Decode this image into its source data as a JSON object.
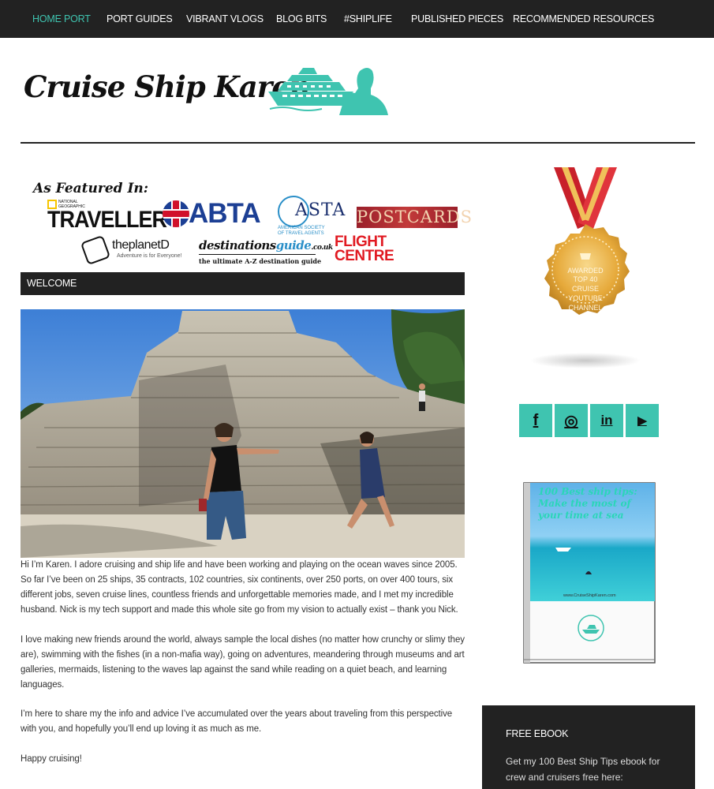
{
  "nav": {
    "items": [
      {
        "label": "HOME PORT",
        "active": true
      },
      {
        "label": "PORT GUIDES"
      },
      {
        "label": "VIBRANT VLOGS"
      },
      {
        "label": "BLOG BITS"
      },
      {
        "label": "#SHIPLIFE"
      },
      {
        "label": "PUBLISHED PIECES"
      },
      {
        "label": "RECOMMENDED RESOURCES"
      }
    ]
  },
  "header": {
    "logo_text": "Cruise Ship Karen"
  },
  "featured": {
    "title": "As Featured In:",
    "natgeo": "NATIONAL\nGEOGRAPHIC",
    "traveller": "TRAVELLER",
    "abta": "ABTA",
    "asta": "ASTA",
    "asta_sub": "AMERICAN SOCIETY\nOF TRAVEL AGENTS",
    "postcards": "POSTCARDS",
    "planetd": "theplanetD",
    "planetd_sub": "Adventure is for Everyone!",
    "destguide_a": "destinations",
    "destguide_b": "guide",
    "destguide_c": ".co.uk",
    "destguide_sub": "the ultimate A-Z destination guide",
    "flight": "FLIGHT\nCENTRE"
  },
  "welcome": {
    "title": "WELCOME",
    "paragraphs": [
      "Hi I’m Karen. I adore cruising and ship life and have been working and playing on the ocean waves since 2005. So far I’ve been on 25 ships, 35 contracts, 102 countries, six continents, over 250 ports, on over 400 tours, six different jobs, seven cruise lines, countless friends and unforgettable memories made, and I met my incredible husband. Nick is my tech support and made this whole site go from my vision to actually exist – thank you Nick.",
      "I love making new friends around the world, always sample the local dishes (no matter how crunchy or slimy they are), swimming with the fishes (in a non-mafia way), going on adventures, meandering through museums and art galleries, mermaids, listening to the waves lap against the sand while reading on a quiet beach, and learning languages.",
      "I’m here to share my the info and advice I’ve accumulated over the years about traveling from this perspective with you, and hopefully you’ll end up loving it as much as me.",
      "Happy cruising!"
    ]
  },
  "sidebar": {
    "badge_lines": [
      "AWARDED",
      "TOP 40",
      "CRUISE",
      "YOUTUBE",
      "CHANNEL"
    ],
    "social": [
      {
        "name": "facebook",
        "glyph": "f"
      },
      {
        "name": "instagram",
        "glyph": "◎"
      },
      {
        "name": "linkedin",
        "glyph": "in"
      },
      {
        "name": "youtube",
        "glyph": "▶"
      }
    ],
    "ebook_cover_title": "100 Best ship tips: Make the most of your time at sea",
    "ebook_url": "www.CruiseShipKaren.com",
    "free_title": "FREE EBOOK",
    "free_text": "Get my 100 Best Ship Tips ebook for crew and cruisers free here:"
  },
  "colors": {
    "accent": "#3fc4b0",
    "dark": "#222222"
  }
}
